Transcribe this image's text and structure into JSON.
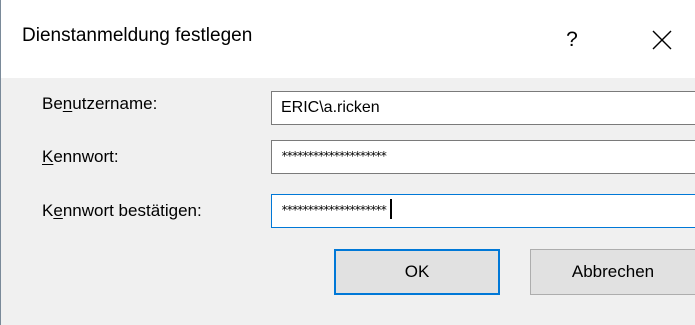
{
  "dialog": {
    "title": "Dienstanmeldung festlegen",
    "help_label": "?",
    "close_icon": "close-icon"
  },
  "form": {
    "username_label_pre": "Be",
    "username_label_accel": "n",
    "username_label_post": "utzername:",
    "username_value": "ERIC\\a.ricken",
    "password_label_accel": "K",
    "password_label_post": "ennwort:",
    "password_value": "********************",
    "confirm_label_pre": "K",
    "confirm_label_accel": "e",
    "confirm_label_post": "nnwort bestätigen:",
    "confirm_value": "********************"
  },
  "buttons": {
    "ok_label": "OK",
    "cancel_label": "Abbrechen"
  },
  "colors": {
    "accent": "#0078d7",
    "dialog_background": "#f0f0f0",
    "button_background": "#e1e1e1"
  }
}
